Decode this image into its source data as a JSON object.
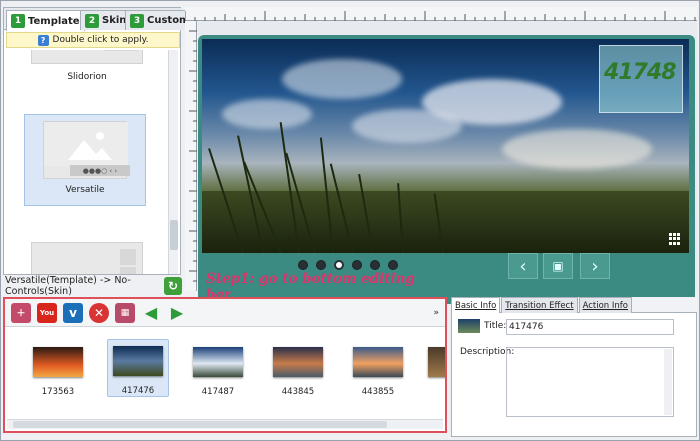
{
  "left_panel": {
    "tabs": [
      {
        "num": "1",
        "label": "Template"
      },
      {
        "num": "2",
        "label": "Skin"
      },
      {
        "num": "3",
        "label": "Custom"
      }
    ],
    "hint": "Double click to apply.",
    "templates": [
      {
        "label": "Slidorion"
      },
      {
        "label": "Versatile"
      }
    ],
    "status": "Versatile(Template) -> No-Controls(Skin)"
  },
  "preview": {
    "overlay_number": "41748",
    "active_dot": 3,
    "dot_count": 6
  },
  "callout": "Step1: go to bottom editing bar",
  "image_bar": {
    "images": [
      {
        "id": "173563",
        "colors": [
          "#2a1a12",
          "#e05a22",
          "#f2a844"
        ]
      },
      {
        "id": "417476",
        "colors": [
          "#0d2a52",
          "#5a7aa0",
          "#3d4a1e"
        ],
        "selected": true
      },
      {
        "id": "417487",
        "colors": [
          "#1a3f7a",
          "#dfe8f2",
          "#3a4a3a"
        ]
      },
      {
        "id": "443845",
        "colors": [
          "#2a2f4a",
          "#c77b4a",
          "#4a5a6a"
        ]
      },
      {
        "id": "443855",
        "colors": [
          "#3a5a8a",
          "#f0a060",
          "#3a4a5a"
        ]
      }
    ]
  },
  "info_panel": {
    "tabs": [
      "Basic Info",
      "Transition Effect",
      "Action Info"
    ],
    "title_label": "Title:",
    "title_value": "417476",
    "description_label": "Description:"
  },
  "colors": {
    "accent_green": "#2e9b3a",
    "frame_teal": "#3c8b82",
    "callout_pink": "#e0326c",
    "highlight_red": "#e0505a"
  }
}
